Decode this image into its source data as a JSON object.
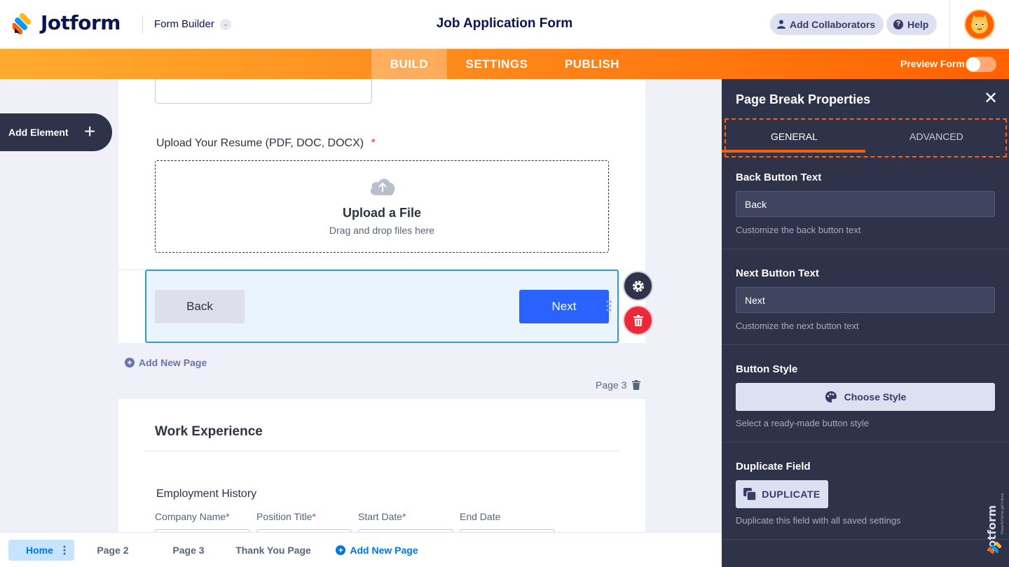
{
  "header": {
    "brand": "Jotform",
    "form_builder": "Form Builder",
    "title": "Job Application Form",
    "add_collaborators": "Add Collaborators",
    "help": "Help"
  },
  "nav": {
    "tabs": [
      "BUILD",
      "SETTINGS",
      "PUBLISH"
    ],
    "active_tab": "BUILD",
    "preview_label": "Preview Form",
    "preview_on": false
  },
  "sidebar": {
    "add_element": "Add Element"
  },
  "form": {
    "upload_label": "Upload Your Resume (PDF, DOC, DOCX)",
    "required_mark": "*",
    "upload_title": "Upload a File",
    "upload_sub": "Drag and drop files here",
    "back_button": "Back",
    "next_button": "Next",
    "add_new_page": "Add New Page",
    "page3_label": "Page 3",
    "section_title": "Work Experience",
    "employment_history": "Employment History",
    "columns": [
      {
        "label": "Company Name",
        "required": true
      },
      {
        "label": "Position Title",
        "required": true
      },
      {
        "label": "Start Date",
        "required": true
      },
      {
        "label": "End Date",
        "required": false
      }
    ]
  },
  "bottom": {
    "tabs": [
      "Home",
      "Page 2",
      "Page 3",
      "Thank You Page"
    ],
    "active": "Home",
    "add_new_page": "Add New Page"
  },
  "panel": {
    "title": "Page Break Properties",
    "tabs": [
      "GENERAL",
      "ADVANCED"
    ],
    "active_tab": "GENERAL",
    "back_label": "Back Button Text",
    "back_value": "Back",
    "back_hint": "Customize the back button text",
    "next_label": "Next Button Text",
    "next_value": "Next",
    "next_hint": "Customize the next button text",
    "style_label": "Button Style",
    "choose_style": "Choose Style",
    "style_hint": "Select a ready-made button style",
    "dup_label": "Duplicate Field",
    "dup_button": "DUPLICATE",
    "dup_hint": "Duplicate this field with all saved settings",
    "watermark": "Jotform",
    "watermark_sub": "Powerful forms get it done."
  },
  "colors": {
    "orange": "#ff6100",
    "navy": "#0a1551",
    "panel_bg": "#2f3349",
    "blue": "#2962ff",
    "red": "#ea2a3a"
  }
}
